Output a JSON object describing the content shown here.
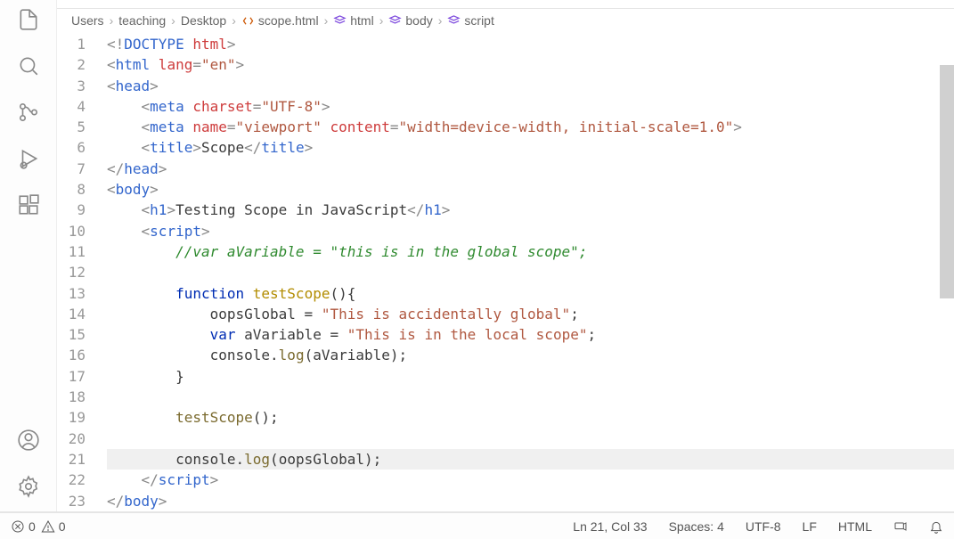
{
  "breadcrumb": {
    "items": [
      {
        "label": "Users",
        "icon": null
      },
      {
        "label": "teaching",
        "icon": null
      },
      {
        "label": "Desktop",
        "icon": null
      },
      {
        "label": "scope.html",
        "icon": "file"
      },
      {
        "label": "html",
        "icon": "element"
      },
      {
        "label": "body",
        "icon": "element"
      },
      {
        "label": "script",
        "icon": "element"
      }
    ]
  },
  "gutter": {
    "count": 23
  },
  "code": {
    "lines": [
      {
        "i": 1,
        "s": [
          [
            "<!",
            "gray"
          ],
          [
            "DOCTYPE",
            "blue"
          ],
          [
            " ",
            "gray"
          ],
          [
            "html",
            "red"
          ],
          [
            ">",
            "gray"
          ]
        ]
      },
      {
        "i": 2,
        "s": [
          [
            "<",
            "gray"
          ],
          [
            "html",
            "blue"
          ],
          [
            " lang",
            "red"
          ],
          [
            "=",
            "gray"
          ],
          [
            "\"en\"",
            "str"
          ],
          [
            ">",
            "gray"
          ]
        ]
      },
      {
        "i": 3,
        "s": [
          [
            "<",
            "gray"
          ],
          [
            "head",
            "blue"
          ],
          [
            ">",
            "gray"
          ]
        ]
      },
      {
        "i": 4,
        "s": [
          [
            "    ",
            ""
          ],
          [
            "<",
            "gray"
          ],
          [
            "meta",
            "blue"
          ],
          [
            " charset",
            "red"
          ],
          [
            "=",
            "gray"
          ],
          [
            "\"UTF-8\"",
            "str"
          ],
          [
            ">",
            "gray"
          ]
        ]
      },
      {
        "i": 5,
        "s": [
          [
            "    ",
            ""
          ],
          [
            "<",
            "gray"
          ],
          [
            "meta",
            "blue"
          ],
          [
            " name",
            "red"
          ],
          [
            "=",
            "gray"
          ],
          [
            "\"viewport\"",
            "str"
          ],
          [
            " content",
            "red"
          ],
          [
            "=",
            "gray"
          ],
          [
            "\"width=device-width, initial-scale=1.0\"",
            "str"
          ],
          [
            ">",
            "gray"
          ]
        ]
      },
      {
        "i": 6,
        "s": [
          [
            "    ",
            ""
          ],
          [
            "<",
            "gray"
          ],
          [
            "title",
            "blue"
          ],
          [
            ">",
            "gray"
          ],
          [
            "Scope",
            "text"
          ],
          [
            "</",
            "gray"
          ],
          [
            "title",
            "blue"
          ],
          [
            ">",
            "gray"
          ]
        ]
      },
      {
        "i": 7,
        "s": [
          [
            "</",
            "gray"
          ],
          [
            "head",
            "blue"
          ],
          [
            ">",
            "gray"
          ]
        ]
      },
      {
        "i": 8,
        "s": [
          [
            "<",
            "gray"
          ],
          [
            "body",
            "blue"
          ],
          [
            ">",
            "gray"
          ]
        ]
      },
      {
        "i": 9,
        "s": [
          [
            "    ",
            ""
          ],
          [
            "<",
            "gray"
          ],
          [
            "h1",
            "blue"
          ],
          [
            ">",
            "gray"
          ],
          [
            "Testing Scope in JavaScript",
            "text"
          ],
          [
            "</",
            "gray"
          ],
          [
            "h1",
            "blue"
          ],
          [
            ">",
            "gray"
          ]
        ]
      },
      {
        "i": 10,
        "s": [
          [
            "    ",
            ""
          ],
          [
            "<",
            "gray"
          ],
          [
            "script",
            "blue"
          ],
          [
            ">",
            "gray"
          ]
        ]
      },
      {
        "i": 11,
        "s": [
          [
            "        ",
            ""
          ],
          [
            "//var aVariable = \"this is in the global scope\";",
            "green"
          ]
        ],
        "italic": true
      },
      {
        "i": 12,
        "s": [
          [
            "",
            ""
          ]
        ]
      },
      {
        "i": 13,
        "s": [
          [
            "        ",
            ""
          ],
          [
            "function",
            "darkblue"
          ],
          [
            " ",
            "text"
          ],
          [
            "testScope",
            "yellow"
          ],
          [
            "(){",
            "text"
          ]
        ]
      },
      {
        "i": 14,
        "s": [
          [
            "            ",
            ""
          ],
          [
            "oopsGlobal",
            "text"
          ],
          [
            " = ",
            "text"
          ],
          [
            "\"This is accidentally global\"",
            "str"
          ],
          [
            ";",
            "text"
          ]
        ]
      },
      {
        "i": 15,
        "s": [
          [
            "            ",
            ""
          ],
          [
            "var",
            "darkblue"
          ],
          [
            " ",
            "text"
          ],
          [
            "aVariable",
            "text"
          ],
          [
            " = ",
            "text"
          ],
          [
            "\"This is in the local scope\"",
            "str"
          ],
          [
            ";",
            "text"
          ]
        ]
      },
      {
        "i": 16,
        "s": [
          [
            "            ",
            ""
          ],
          [
            "console",
            "text"
          ],
          [
            ".",
            "text"
          ],
          [
            "log",
            "dyellow"
          ],
          [
            "(",
            "text"
          ],
          [
            "aVariable",
            "text"
          ],
          [
            ");",
            "text"
          ]
        ]
      },
      {
        "i": 17,
        "s": [
          [
            "        ",
            ""
          ],
          [
            "}",
            "text"
          ]
        ]
      },
      {
        "i": 18,
        "s": [
          [
            "",
            ""
          ]
        ]
      },
      {
        "i": 19,
        "s": [
          [
            "        ",
            ""
          ],
          [
            "testScope",
            "dyellow"
          ],
          [
            "();",
            "text"
          ]
        ]
      },
      {
        "i": 20,
        "s": [
          [
            "",
            ""
          ]
        ]
      },
      {
        "i": 21,
        "s": [
          [
            "        ",
            ""
          ],
          [
            "console",
            "text"
          ],
          [
            ".",
            "text"
          ],
          [
            "log",
            "dyellow"
          ],
          [
            "(",
            "text"
          ],
          [
            "oopsGlobal",
            "text"
          ],
          [
            ");",
            "text"
          ]
        ],
        "hl": true
      },
      {
        "i": 22,
        "s": [
          [
            "    ",
            ""
          ],
          [
            "</",
            "gray"
          ],
          [
            "script",
            "blue"
          ],
          [
            ">",
            "gray"
          ]
        ]
      },
      {
        "i": 23,
        "s": [
          [
            "</",
            "gray"
          ],
          [
            "body",
            "blue"
          ],
          [
            ">",
            "gray"
          ]
        ]
      }
    ]
  },
  "status": {
    "errors": "0",
    "warnings": "0",
    "line_col": "Ln 21, Col 33",
    "spaces": "Spaces: 4",
    "encoding": "UTF-8",
    "eol": "LF",
    "language": "HTML"
  }
}
